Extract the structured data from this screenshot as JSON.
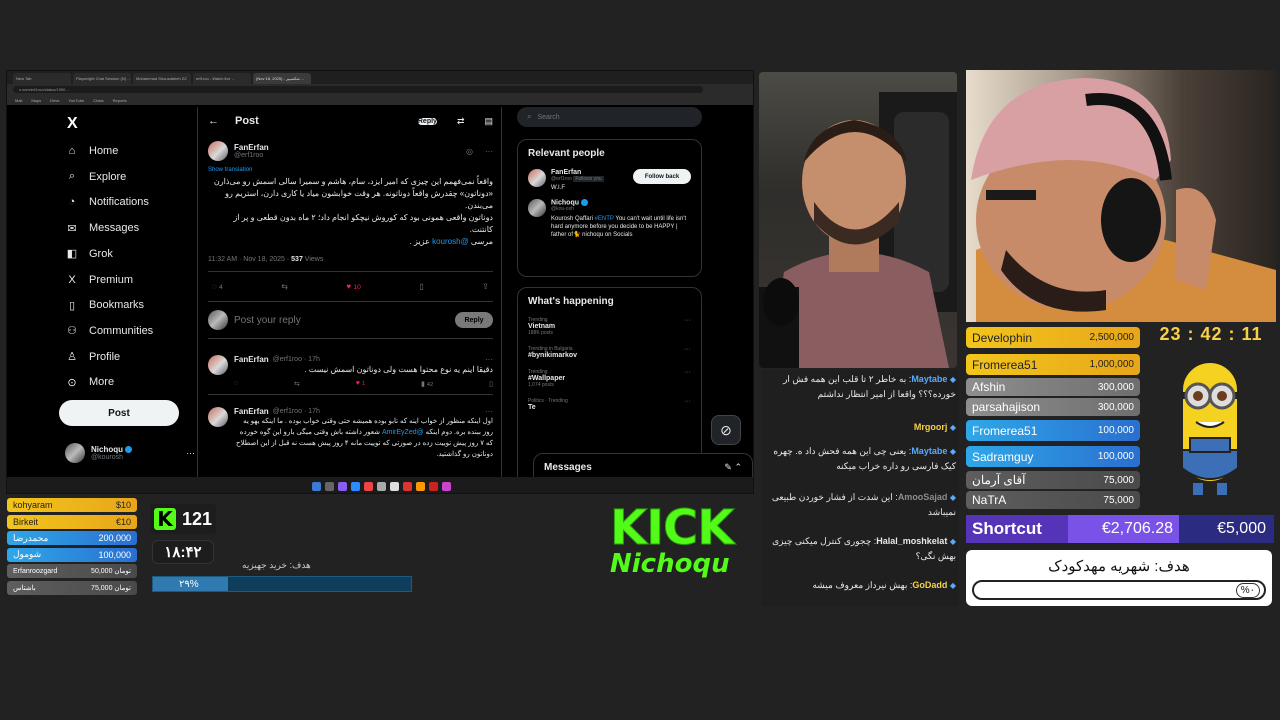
{
  "browser": {
    "tabs": [
      "New Tab",
      "Playwright Chat Session (N) …",
      "Mohammad Sirousdaheh ZZ",
      "erf1roo - Watch live ...",
      "(Nov 18, 2025) - شکسپیر ..."
    ],
    "url": "x.com/erf1roo/status/1990…",
    "bookmarks": [
      "Mail",
      "Maps",
      "Drive",
      "YouTube",
      "Chats",
      "Reports"
    ]
  },
  "xnav": {
    "logo": "X",
    "items": [
      {
        "label": "Home",
        "icon": "home-icon",
        "glyph": "⌂"
      },
      {
        "label": "Explore",
        "icon": "search-icon",
        "glyph": "⌕"
      },
      {
        "label": "Notifications",
        "icon": "bell-icon",
        "glyph": "◔"
      },
      {
        "label": "Messages",
        "icon": "mail-icon",
        "glyph": "✉"
      },
      {
        "label": "Grok",
        "icon": "grok-icon",
        "glyph": "◧"
      },
      {
        "label": "Premium",
        "icon": "x-premium-icon",
        "glyph": "X"
      },
      {
        "label": "Bookmarks",
        "icon": "bookmark-icon",
        "glyph": "▯"
      },
      {
        "label": "Communities",
        "icon": "communities-icon",
        "glyph": "⚇"
      },
      {
        "label": "Profile",
        "icon": "person-icon",
        "glyph": "♙"
      },
      {
        "label": "More",
        "icon": "more-circle-icon",
        "glyph": "⊙"
      }
    ],
    "post_label": "Post",
    "account": {
      "name": "Nichoqu",
      "handle": "@kourosh"
    }
  },
  "post": {
    "header": "Post",
    "reply_label": "Reply",
    "author": "FanErfan",
    "handle": "@erf1roo",
    "show_translation": "Show translation",
    "text1": "واقعاً نمی‌فهمم این چیزی که امیر ایزد، سام، هاشم و سمیرا سالی اسمش رو می‌ذارن «دوناتون» چقدرش واقعاً دوناتونه. هر وقت خوابشون میاد یا کاری دارن، استریم رو می‌بندن.",
    "text2": "دوناتون واقعی همونی بود که کوروش نیچکو انجام داد؛ ۲ ماه بدون قطعی و پر از کانتنت.",
    "text3": "مرسی",
    "mention": "@kourosh",
    "text3b": "عزیز .",
    "time": "11:32 AM · Nov 18, 2025 ·",
    "views": "537",
    "views_label": "Views",
    "stats": {
      "replies": "4",
      "likes": "10"
    },
    "reply_placeholder": "Post your reply",
    "reply_button": "Reply"
  },
  "replies": [
    {
      "author": "FanErfan",
      "handle": "@erf1roo · 17h",
      "text": "دقیقا اینم یه نوع محتوا هست ولی دوناتون اسمش نیست .",
      "likes": "1",
      "views": "42"
    },
    {
      "author": "FanErfan",
      "handle": "@erf1roo · 17h",
      "text_a": "اول اینکه منظور از خواب اینه که تابو بوده همیشه حتی وقتی خواب بوده . ما اینکه یهو یه روز ببنده بره. دوم اینکه",
      "mention": "@AmirEyZed",
      "text_b": "شعور داشته باش وقتی میگی بارو این گوه خورده که ۷ روز پیش توییت زده در صورتی که توییت مانه ۴ روز پیش هست نه قبل از این اصطلاح دوناتون رو گذاشتید."
    }
  ],
  "sidebar": {
    "search_placeholder": "Search",
    "relevant_title": "Relevant people",
    "people": [
      {
        "name": "FanErfan",
        "handle": "@erf1roo",
        "badge": "Follows you",
        "bio": "W.I.F",
        "button": "Follow back"
      },
      {
        "name": "Nichoqu",
        "handle": "@kou-osh",
        "bio_a": "Kourosh Qaffari",
        "tag": "#ENTP",
        "bio_b": "You can't wait until life isn't hard anymore before you decide to be HAPPY | father of🐈 nichoqu on Socials"
      }
    ],
    "whats_happening": "What's happening",
    "trends": [
      {
        "cat": "Trending",
        "name": "Vietnam",
        "count": "188K posts"
      },
      {
        "cat": "Trending in Bulgaria",
        "name": "#bynikimarkov",
        "count": ""
      },
      {
        "cat": "Trending",
        "name": "#Wallpaper",
        "count": "1,074 posts"
      },
      {
        "cat": "Politics · Trending",
        "name": "Te",
        "count": ""
      }
    ],
    "messages_label": "Messages"
  },
  "chat": [
    {
      "user": "Maytabe",
      "user_color": "#5aa9ff",
      "text": ": به خاطر ۲ تا قلب این همه فش ار خورده؟؟؟ واقعا از امیر انتظار نداشتم"
    },
    {
      "user": "Mrgoorj",
      "user_color": "#f7d047",
      "text": ""
    },
    {
      "user": "Maytabe",
      "user_color": "#5aa9ff",
      "text": ": یعنی چی این همه فحش داد ه. چهره کیک فارسی رو داره خراب میکنه"
    },
    {
      "user": "AmooSajad",
      "user_color": "#8c8c8c",
      "text": ": این شدت از فشار خوردن طبیعی نمیباشد"
    },
    {
      "user": "Halal_moshkelat",
      "user_color": "#e7e9ea",
      "text": ": چجوری کنترل میکنی چیزی بهش نگی؟"
    },
    {
      "user": "GoDadd",
      "user_color": "#f7d047",
      "text": ": بهش نیرداز معروف میشه"
    }
  ],
  "leaderboard_right": [
    {
      "name": "Develophin",
      "value": "2,500,000",
      "style": "gold"
    },
    {
      "name": "Fromerea51",
      "value": "1,000,000",
      "style": "gold"
    },
    {
      "name": "Afshin",
      "value": "300,000",
      "style": "silver"
    },
    {
      "name": "parsahajison",
      "value": "300,000",
      "style": "silver"
    },
    {
      "name": "Fromerea51",
      "value": "100,000",
      "style": "blue"
    },
    {
      "name": "Sadramguy",
      "value": "100,000",
      "style": "blue"
    },
    {
      "name": "آقای آرمان",
      "value": "75,000",
      "style": "gray"
    },
    {
      "name": "NaTrA",
      "value": "75,000",
      "style": "gray"
    }
  ],
  "clock": "23 : 42 : 11",
  "shortcut": {
    "label": "Shortcut",
    "current": "€2,706.28",
    "target": "€5,000",
    "progress": 0.54
  },
  "goal_right": {
    "label": "هدف: شهریه مهدکودک",
    "percent": "%۰"
  },
  "leaderboard_left": [
    {
      "name": "kohyaram",
      "value": "$10",
      "style": "gold"
    },
    {
      "name": "Birkeit",
      "value": "€10",
      "style": "gold"
    },
    {
      "name": "محمدرضا",
      "value": "200,000",
      "style": "blue"
    },
    {
      "name": "شومول",
      "value": "100,000",
      "style": "blue"
    },
    {
      "name": "Erfanroozgard",
      "value": "50,000 تومان",
      "style": "gray"
    },
    {
      "name": "باشتاس",
      "value": "75,000 تومان",
      "style": "gray"
    }
  ],
  "kick": {
    "viewers": "121",
    "timer": "۱۸:۴۲",
    "goal_label": "هدف: خرید جهیزیه",
    "goal_percent": "۲۹%",
    "goal_progress": 0.29,
    "logo_text": "KICK",
    "channel": "Nichoqu",
    "brand_color": "#53fc18"
  }
}
